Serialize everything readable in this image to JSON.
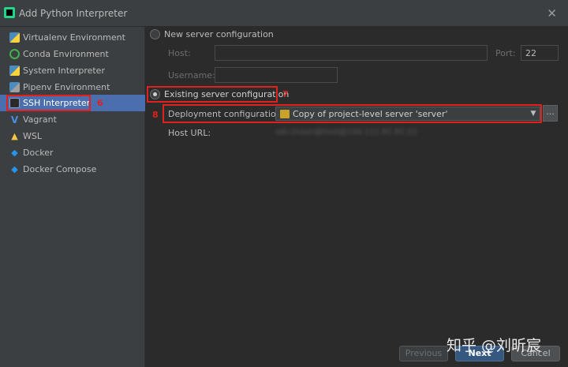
{
  "window": {
    "title": "Add Python Interpreter",
    "close_glyph": "✕"
  },
  "sidebar": {
    "items": [
      {
        "label": "Virtualenv Environment",
        "icon": "virtualenv-icon"
      },
      {
        "label": "Conda Environment",
        "icon": "conda-icon"
      },
      {
        "label": "System Interpreter",
        "icon": "python-icon"
      },
      {
        "label": "Pipenv Environment",
        "icon": "pipenv-icon"
      },
      {
        "label": "SSH Interpreter",
        "icon": "ssh-terminal-icon",
        "selected": true
      },
      {
        "label": "Vagrant",
        "icon": "vagrant-icon"
      },
      {
        "label": "WSL",
        "icon": "wsl-penguin-icon"
      },
      {
        "label": "Docker",
        "icon": "docker-icon"
      },
      {
        "label": "Docker Compose",
        "icon": "docker-compose-icon"
      }
    ]
  },
  "annotations": {
    "ssh": "6",
    "existing": "7",
    "deployment": "8"
  },
  "form": {
    "new_server_label": "New server configuration",
    "host_label": "Host:",
    "host_value": "",
    "port_label": "Port:",
    "port_value": "22",
    "username_label": "Username:",
    "username_value": "",
    "existing_label": "Existing server configuration",
    "deployment_label": "Deployment configuration:",
    "deployment_value": "Copy of project-level server 'server'",
    "host_url_label": "Host URL:",
    "host_url_value": "sdc://user@host@100.111.81.81:22"
  },
  "buttons": {
    "previous": "Previous",
    "next": "Next",
    "cancel": "Cancel"
  },
  "watermark": "知乎 @刘昕宸",
  "colors": {
    "accent": "#4b6eaf",
    "annotation_red": "#e0211d",
    "next_button": "#365880"
  }
}
